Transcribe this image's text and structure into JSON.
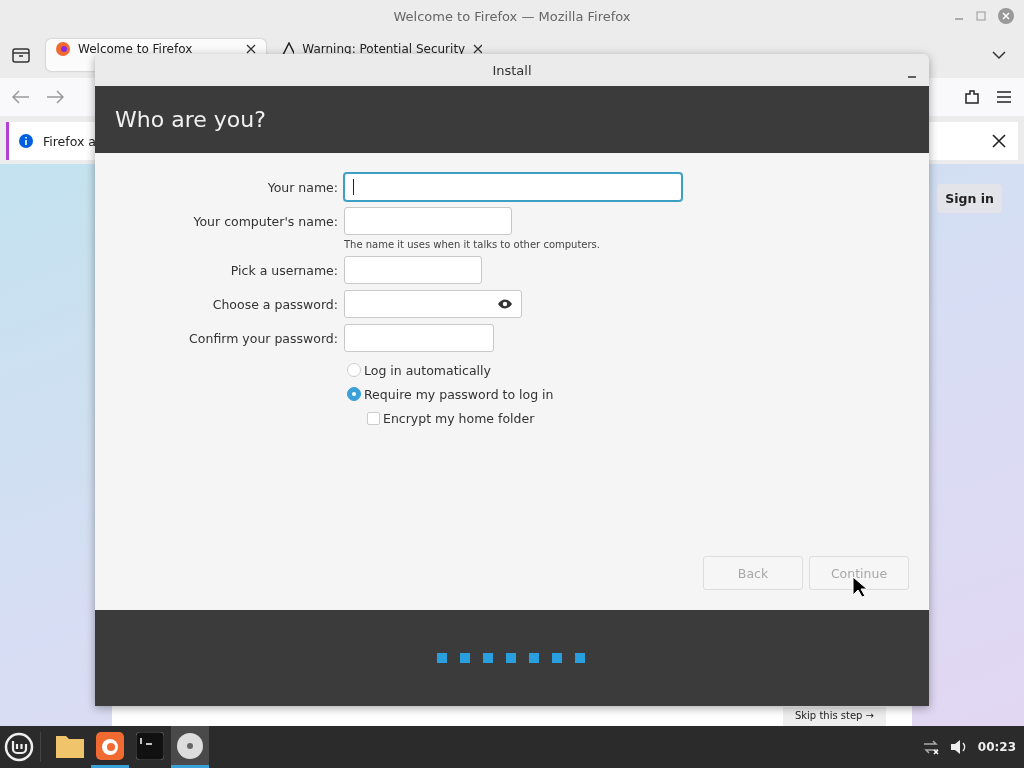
{
  "browser": {
    "title": "Welcome to Firefox — Mozilla Firefox",
    "tabs": [
      {
        "label": "Welcome to Firefox",
        "kind": "firefox",
        "selected": true
      },
      {
        "label": "Warning: Potential Security",
        "kind": "warning",
        "selected": false
      }
    ],
    "notification": "Firefox a",
    "sign_in": "Sign in",
    "skip_link": "Skip this step →"
  },
  "dialog": {
    "title": "Install",
    "heading": "Who are you?",
    "fields": [
      {
        "label": "Your name:",
        "kind": "text",
        "focused": true
      },
      {
        "label": "Your computer's name:",
        "kind": "text",
        "focused": false,
        "hint": "The name it uses when it talks to other computers."
      },
      {
        "label": "Pick a username:",
        "kind": "text",
        "focused": false
      },
      {
        "label": "Choose a password:",
        "kind": "password",
        "focused": false
      },
      {
        "label": "Confirm your password:",
        "kind": "text",
        "focused": false
      }
    ],
    "login_options": [
      {
        "label": "Log in automatically",
        "selected": false
      },
      {
        "label": "Require my password to log in",
        "selected": true
      }
    ],
    "encrypt": {
      "label": "Encrypt my home folder",
      "checked": false
    },
    "buttons": [
      {
        "label": "Back",
        "disabled": true
      },
      {
        "label": "Continue",
        "disabled": true
      }
    ]
  },
  "taskbar": {
    "apps": [
      {
        "kind": "files",
        "running": false,
        "active": false
      },
      {
        "kind": "firefox",
        "running": true,
        "active": false
      },
      {
        "kind": "terminal",
        "running": false,
        "active": false
      },
      {
        "kind": "disc",
        "running": true,
        "active": true
      }
    ],
    "clock": "00:23"
  }
}
